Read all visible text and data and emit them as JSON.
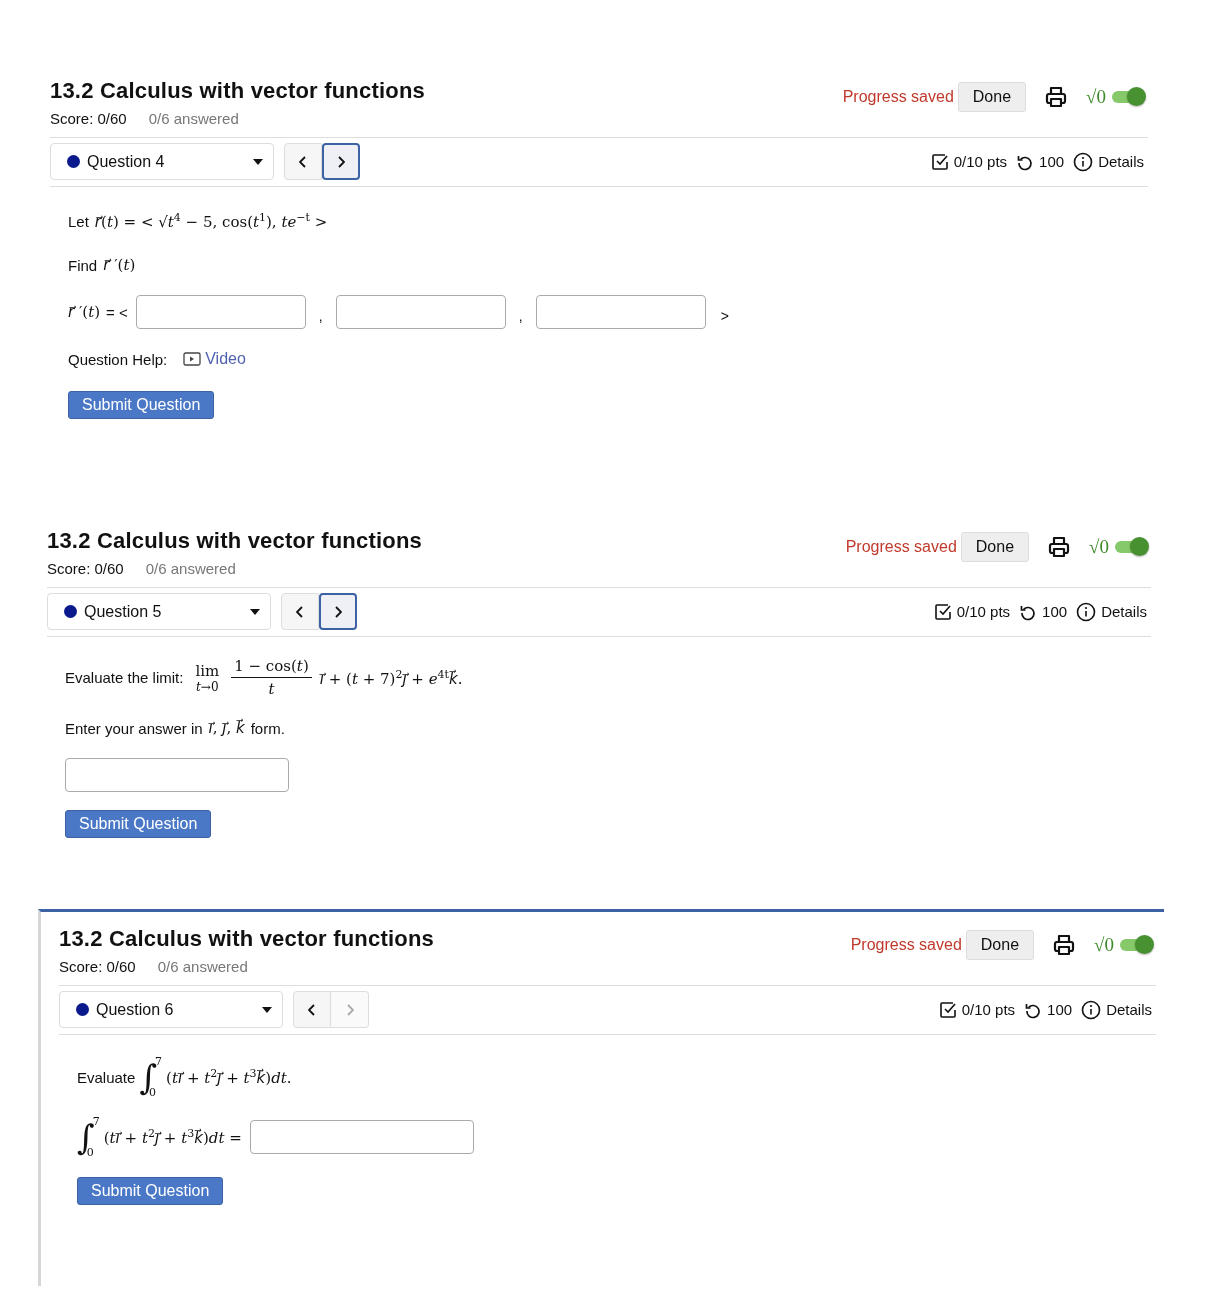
{
  "panels": [
    {
      "active": false,
      "title": "13.2 Calculus with vector functions",
      "score": "Score: 0/60",
      "answered": "0/6 answered",
      "progress": "Progress saved",
      "done": "Done",
      "math_label": "√0",
      "math_on": true,
      "question": {
        "label": "Question 4",
        "color": "#0a1a8c"
      },
      "nav": {
        "prev_disabled": false,
        "next_disabled": false,
        "next_focused": true
      },
      "pts": "0/10 pts",
      "attempts": "100",
      "details": "Details",
      "body": [
        {
          "kind": "text",
          "segments": [
            {
              "kind": "plain",
              "text": "Let"
            },
            {
              "kind": "math",
              "text": "*r⃗*(*t*) =  < √*t*$^{4}$ − 5, cos(*t*$^{1}$), *te*$^{−t}$ >"
            }
          ]
        },
        {
          "kind": "text",
          "segments": [
            {
              "kind": "plain",
              "text": "Find"
            },
            {
              "kind": "math",
              "text": "*r⃗* ′(*t*)"
            }
          ]
        },
        {
          "kind": "vector-inputs",
          "label": [
            {
              "kind": "math",
              "text": "*r⃗* ′(*t*)"
            },
            {
              "kind": "plain",
              "text": "= <"
            }
          ],
          "separators": [
            ",",
            ","
          ],
          "closing": ">"
        },
        {
          "kind": "help",
          "label": "Question Help:",
          "link": "Video"
        }
      ],
      "submit": "Submit Question"
    },
    {
      "active": false,
      "title": "13.2 Calculus with vector functions",
      "score": "Score: 0/60",
      "answered": "0/6 answered",
      "progress": "Progress saved",
      "done": "Done",
      "math_label": "√0",
      "math_on": true,
      "question": {
        "label": "Question 5",
        "color": "#0a1a8c"
      },
      "nav": {
        "prev_disabled": false,
        "next_disabled": false,
        "next_focused": true
      },
      "pts": "0/10 pts",
      "attempts": "100",
      "details": "Details",
      "body": [
        {
          "kind": "limit",
          "lead": "Evaluate the limit:",
          "op": "lim",
          "under": "*t*→0",
          "numerator": "1 − cos(*t*)",
          "denominator": "*t*",
          "tail": "*i⃗* + (*t* + 7)$^{2}$*j⃗* + *e*$^{4t}$*k⃗*."
        },
        {
          "kind": "text",
          "segments": [
            {
              "kind": "plain",
              "text": "Enter your answer in"
            },
            {
              "kind": "math",
              "text": "*i⃗*, *j⃗*, *k⃗*"
            },
            {
              "kind": "plain",
              "text": "form."
            }
          ]
        },
        {
          "kind": "field"
        }
      ],
      "submit": "Submit Question"
    },
    {
      "active": true,
      "title": "13.2 Calculus with vector functions",
      "score": "Score: 0/60",
      "answered": "0/6 answered",
      "progress": "Progress saved",
      "done": "Done",
      "math_label": "√0",
      "math_on": true,
      "question": {
        "label": "Question 6",
        "color": "#0a1a8c"
      },
      "nav": {
        "prev_disabled": false,
        "next_disabled": true,
        "next_focused": false
      },
      "pts": "0/10 pts",
      "attempts": "100",
      "details": "Details",
      "body": [
        {
          "kind": "integral",
          "lead": "Evaluate",
          "sign": "∫",
          "upper": "7",
          "lower": "0",
          "integrand": "(*ti⃗* + *t*$^{2}$*j⃗* + *t*$^{3}$*k⃗*)*dt*.",
          "has_field": false
        },
        {
          "kind": "integral",
          "sign": "∫",
          "upper": "7",
          "lower": "0",
          "integrand": "(*ti⃗* + *t*$^{2}$*j⃗* + *t*$^{3}$*k⃗*)*dt* =",
          "has_field": true
        }
      ],
      "submit": "Submit Question"
    }
  ]
}
